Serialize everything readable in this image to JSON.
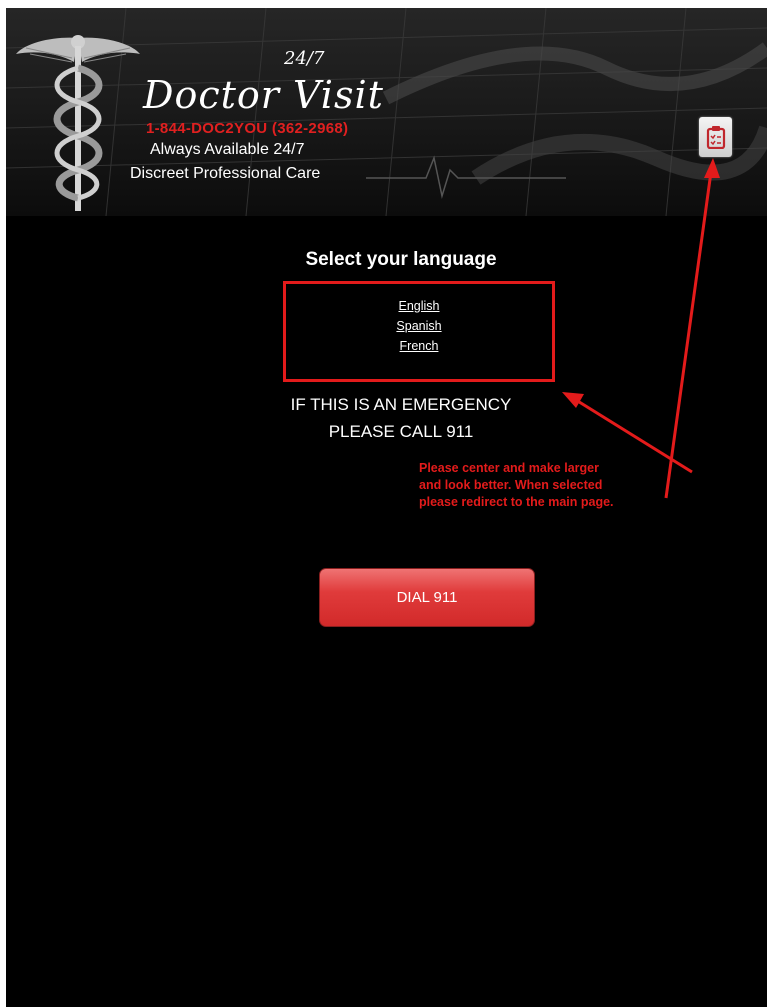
{
  "banner": {
    "logo_title": "Doctor Visit",
    "logo_badge": "24/7",
    "phone": "1-844-DOC2YOU (362-2968)",
    "tagline_1": "Always Available 24/7",
    "tagline_2": "Discreet Professional Care",
    "logo_icon": "caduceus-icon",
    "action_icon": "clipboard-icon"
  },
  "language": {
    "heading": "Select your language",
    "options": [
      "English",
      "Spanish",
      "French"
    ]
  },
  "emergency": {
    "line_1": "IF THIS IS AN EMERGENCY",
    "line_2": "PLEASE CALL 911"
  },
  "annotation": {
    "lines": [
      "Please center and make larger",
      "and look better. When selected",
      "please redirect to the main page."
    ]
  },
  "dial_button": {
    "label": "DIAL 911"
  },
  "colors": {
    "background": "#000000",
    "accent_red": "#e31b1b",
    "button_red": "#d22a2a",
    "text": "#ffffff"
  }
}
